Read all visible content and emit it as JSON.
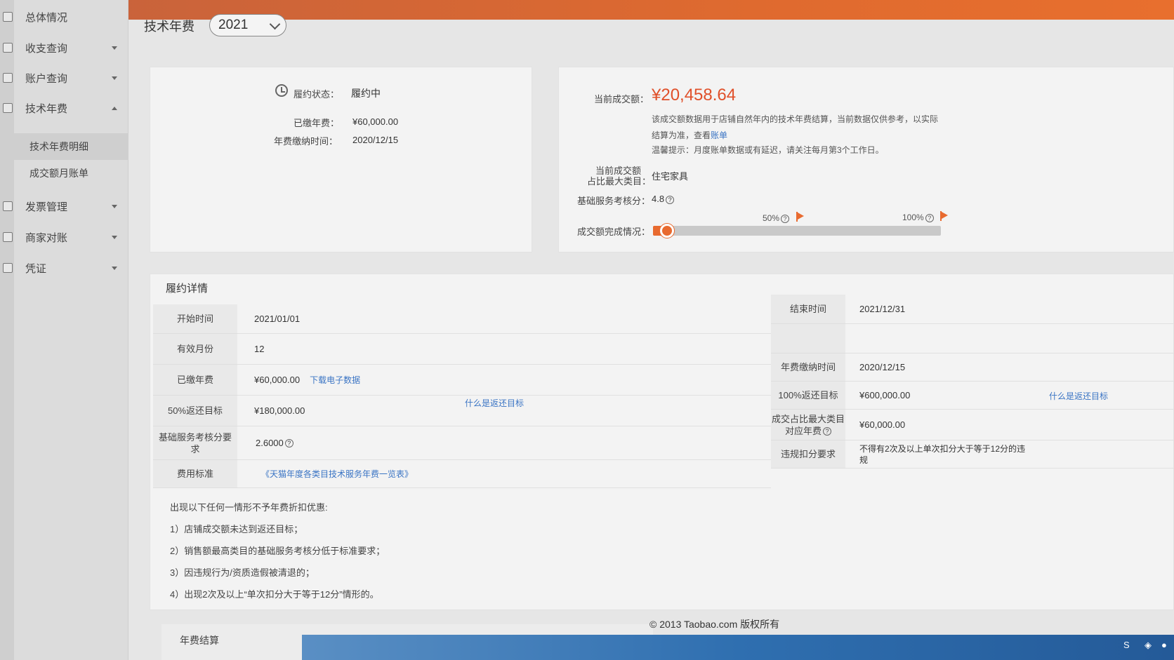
{
  "sidebar": {
    "items": [
      {
        "label": "总体情况"
      },
      {
        "label": "收支查询"
      },
      {
        "label": "账户查询"
      },
      {
        "label": "技术年费"
      },
      {
        "label": "技术年费明细"
      },
      {
        "label": "成交额月账单"
      },
      {
        "label": "发票管理"
      },
      {
        "label": "商家对账"
      },
      {
        "label": "凭证"
      }
    ]
  },
  "header": {
    "title": "技术年费",
    "year": "2021"
  },
  "summary": {
    "status_label": "履约状态：",
    "status_value": "履约中",
    "paid_label": "已缴年费：",
    "paid_value": "¥60,000.00",
    "paid_time_label": "年费缴纳时间：",
    "paid_time_value": "2020/12/15"
  },
  "turnover": {
    "current_label": "当前成交额：",
    "current_value": "¥20,458.64",
    "note_line1": "该成交额数据用于店铺自然年内的技术年费结算，当前数据仅供参考，以实际",
    "note_line2_prefix": "结算为准，查看",
    "note_line2_link": "账单",
    "tip": "温馨提示：月度账单数据或有延迟，请关注每月第3个工作日。",
    "top_cat_label_1": "当前成交额",
    "top_cat_label_2": "占比最大类目：",
    "top_cat_value": "住宅家具",
    "score_label": "基础服务考核分：",
    "score_value": "4.8",
    "progress_label": "成交额完成情况：",
    "progress_fraction": 0.034,
    "mark_50": "50%",
    "mark_100": "100%",
    "accent_color": "#e86a2f"
  },
  "details": {
    "title": "履约详情",
    "start_label": "开始时间",
    "start_value": "2021/01/01",
    "end_label": "结束时间",
    "end_value": "2021/12/31",
    "months_label": "有效月份",
    "months_value": "12",
    "paid_label": "已缴年费",
    "paid_value": "¥60,000.00",
    "download_link": "下载电子数据",
    "paid_time_label": "年费缴纳时间",
    "paid_time_value": "2020/12/15",
    "target50_label": "50%返还目标",
    "target50_value": "¥180,000.00",
    "target_help_1": "什么是返还目标",
    "target100_label": "100%返还目标",
    "target100_value": "¥600,000.00",
    "target_help_2": "什么是返还目标",
    "score_req_label": "基础服务考核分要求",
    "score_req_value": "2.6000",
    "cat_fee_label_1": "成交占比最大类目",
    "cat_fee_label_2": "对应年费",
    "cat_fee_value": "¥60,000.00",
    "fee_std_label": "费用标准",
    "fee_std_link": "《天猫年度各类目技术服务年费一览表》",
    "violation_label": "违规扣分要求",
    "violation_value_1": "不得有2次及以上单次扣分大于等于12分的违",
    "violation_value_2": "规"
  },
  "rules": {
    "heading": "出现以下任何一情形不予年费折扣优惠:",
    "items": [
      "1）店铺成交额未达到返还目标；",
      "2）销售额最高类目的基础服务考核分低于标准要求；",
      "3）因违规行为/资质造假被清退的；",
      "4）出现2次及以上“单次扣分大于等于12分”情形的。"
    ]
  },
  "footer": {
    "copyright": "© 2013 Taobao.com 版权所有",
    "next_section": "年费结算"
  }
}
